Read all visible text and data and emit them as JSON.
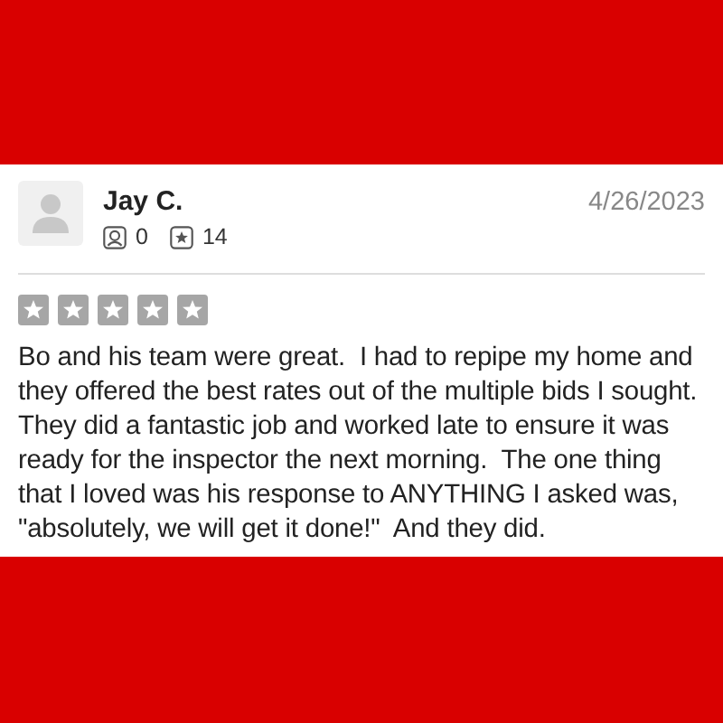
{
  "review": {
    "author": "Jay C.",
    "date": "4/26/2023",
    "friends": "0",
    "reviews": "14",
    "text": "Bo and his team were great.  I had to repipe my home and they offered the best rates out of the multiple bids I sought.  They did a fantastic job and worked late to ensure it was ready for the inspector the next morning.  The one thing that I loved was his response to ANYTHING I asked was, \"absolutely, we will get it done!\"  And they did."
  }
}
